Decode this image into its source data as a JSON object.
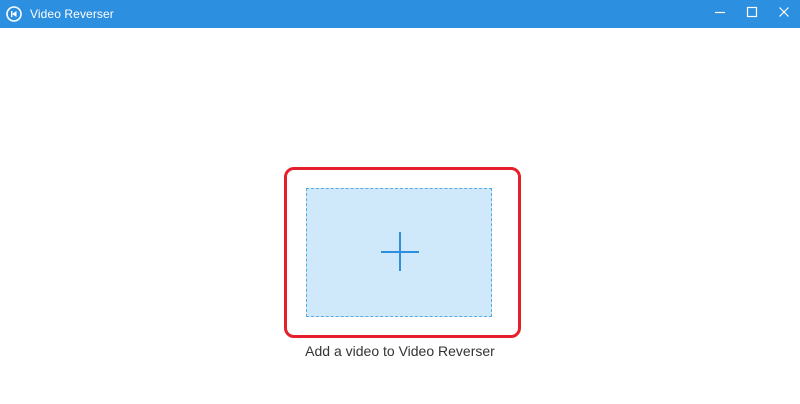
{
  "window": {
    "title": "Video Reverser",
    "app_icon": "video-reverser-logo-icon",
    "controls": {
      "minimize_icon": "minimize-icon",
      "maximize_icon": "maximize-icon",
      "close_icon": "close-icon"
    },
    "accent_color": "#2d8fe0"
  },
  "main": {
    "add_icon": "plus-icon",
    "caption": "Add a video to Video Reverser",
    "highlight_color": "#e5202a",
    "dropzone_color": "#cfe9fb"
  }
}
